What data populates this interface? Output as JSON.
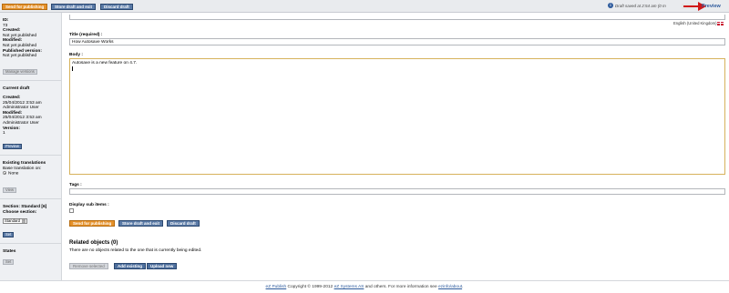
{
  "toolbar": {
    "send_label": "Send for publishing",
    "store_label": "Store draft and exit",
    "discard_label": "Discard draft",
    "draft_info": "Draft saved at 2:54 am (0 m",
    "preview_label": "Preview"
  },
  "sidebar": {
    "id_label": "ID:",
    "id_value": "73",
    "created_label": "Created:",
    "created_value": "Not yet published",
    "modified_label": "Modified:",
    "modified_value": "Not yet published",
    "published_label": "Published version:",
    "published_value": "Not yet published",
    "manage_versions_label": "Manage versions",
    "current_draft_title": "Current draft",
    "cd_created_label": "Created:",
    "cd_created_date": "25/04/2012 3:53 am",
    "cd_created_user": "Administrator User",
    "cd_modified_label": "Modified:",
    "cd_modified_date": "25/04/2012 3:53 am",
    "cd_modified_user": "Administrator User",
    "version_label": "Version:",
    "version_value": "1",
    "preview_label": "Preview",
    "translations_title": "Existing translations",
    "base_translation_label": "Base translation on:",
    "none_label": "None",
    "view_label": "View",
    "section_title": "Section: Standard [6]",
    "choose_section_label": "Choose section:",
    "section_select_value": "Standard",
    "set_label": "Set",
    "states_title": "States",
    "states_set_label": "Set"
  },
  "main": {
    "language": "English (United Kingdom)",
    "title_label": "Title (required) :",
    "title_value": "How Autosave Works",
    "body_label": "Body :",
    "body_value": "Autosave is a new feature on 4.7.",
    "tags_label": "Tags :",
    "display_sub_label": "Display sub items :",
    "send_label": "Send for publishing",
    "store_label": "Store draft and exit",
    "discard_label": "Discard draft",
    "related_title": "Related objects (0)",
    "related_text": "There are no objects related to the one that is currently being edited.",
    "remove_selected_label": "Remove selected",
    "add_existing_label": "Add existing",
    "upload_new_label": "Upload new"
  },
  "footer": {
    "brand": "eZ Publish",
    "copyright": " Copyright © 1999-2012 ",
    "company": "eZ Systems AS",
    "rest": " and others. For more information see ",
    "about": "ezinfo/about",
    "dot": "."
  },
  "colors": {
    "accent_orange": "#e5912a",
    "accent_blue": "#5a7aa6",
    "link_blue": "#2d5a9c"
  }
}
